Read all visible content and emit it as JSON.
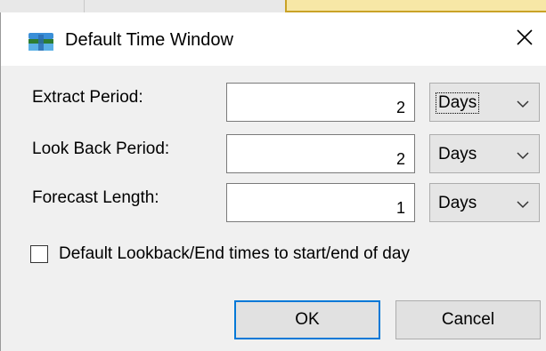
{
  "window": {
    "title": "Default Time Window",
    "app_icon": "ground-water-icon",
    "close_glyph": "✕"
  },
  "fields": [
    {
      "label": "Extract Period:",
      "value": "2",
      "unit": "Days"
    },
    {
      "label": "Look Back Period:",
      "value": "2",
      "unit": "Days"
    },
    {
      "label": "Forecast Length:",
      "value": "1",
      "unit": "Days"
    }
  ],
  "checkbox": {
    "label": "Default Lookback/End times to start/end of day",
    "checked": false
  },
  "buttons": {
    "ok": "OK",
    "cancel": "Cancel"
  },
  "colors": {
    "accent": "#0078d7",
    "background": "#f0f0f0",
    "titlebar": "#ffffff"
  }
}
